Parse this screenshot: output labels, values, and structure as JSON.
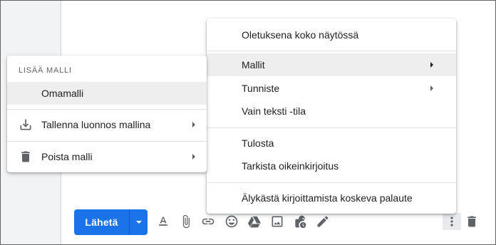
{
  "compose": {
    "send_label": "Lähetä",
    "toolbar_icons": [
      "text-format-icon",
      "attach-icon",
      "link-icon",
      "emoji-icon",
      "drive-icon",
      "photo-icon",
      "confidential-mode-icon",
      "signature-icon",
      "more-options-icon",
      "delete-icon"
    ]
  },
  "more_options_menu": {
    "items": [
      {
        "label": "Oletuksena koko näytössä"
      },
      {
        "label": "Mallit"
      },
      {
        "label": "Tunniste"
      },
      {
        "label": "Vain teksti -tila"
      },
      {
        "label": "Tulosta"
      },
      {
        "label": "Tarkista oikeinkirjoitus"
      },
      {
        "label": "Älykästä kirjoittamista koskeva palaute"
      }
    ]
  },
  "templates_menu": {
    "header": "LISÄÄ MALLI",
    "template_item": "Omamalli",
    "save_draft_label": "Tallenna luonnos mallina",
    "delete_template_label": "Poista malli"
  },
  "colors": {
    "accent": "#1a73e8",
    "highlight": "#eeeeee",
    "icon": "#5f6368"
  }
}
